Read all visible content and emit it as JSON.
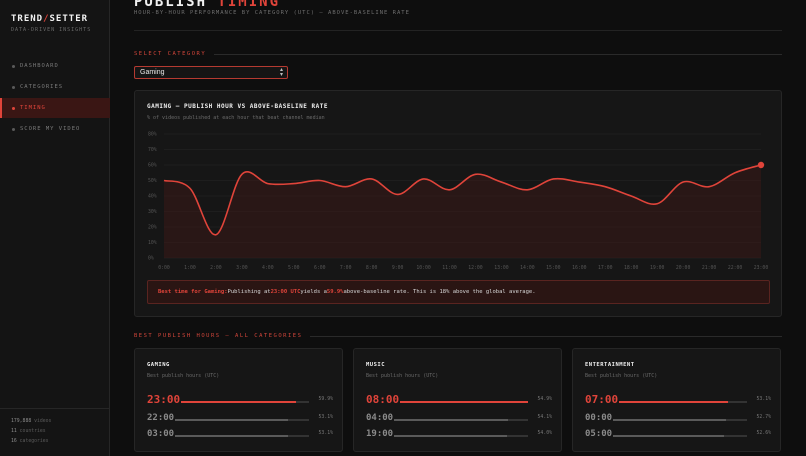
{
  "brand": {
    "name_left": "TREND",
    "name_sep": "/",
    "name_right": "SETTER",
    "tagline": "DATA-DRIVEN INSIGHTS"
  },
  "nav": [
    {
      "label": "DASHBOARD",
      "active": false
    },
    {
      "label": "CATEGORIES",
      "active": false
    },
    {
      "label": "TIMING",
      "active": true
    },
    {
      "label": "SCORE MY VIDEO",
      "active": false
    }
  ],
  "stats": [
    {
      "value": "179,888",
      "label": "videos"
    },
    {
      "value": "11",
      "label": "countries"
    },
    {
      "value": "16",
      "label": "categories"
    }
  ],
  "header": {
    "title_left": "PUBLISH",
    "title_right": "TIMING",
    "subtitle": "HOUR-BY-HOUR PERFORMANCE BY CATEGORY (UTC) — ABOVE-BASELINE RATE"
  },
  "select_section": {
    "label": "SELECT CATEGORY",
    "selected": "Gaming"
  },
  "chart_card": {
    "title": "GAMING — PUBLISH HOUR VS ABOVE-BASELINE RATE",
    "subtitle": "% of videos published at each hour that beat channel median"
  },
  "chart_data": {
    "type": "area",
    "x": [
      "0:00",
      "1:00",
      "2:00",
      "3:00",
      "4:00",
      "5:00",
      "6:00",
      "7:00",
      "8:00",
      "9:00",
      "10:00",
      "11:00",
      "12:00",
      "13:00",
      "14:00",
      "15:00",
      "16:00",
      "17:00",
      "18:00",
      "19:00",
      "20:00",
      "21:00",
      "22:00",
      "23:00"
    ],
    "series": [
      {
        "values": [
          50,
          45,
          15,
          54,
          48,
          48,
          50,
          46,
          51,
          41,
          51,
          44,
          54,
          49,
          44,
          51,
          49,
          46,
          40,
          35,
          49,
          46,
          55,
          60
        ]
      }
    ],
    "yticks": [
      "0%",
      "10%",
      "20%",
      "30%",
      "40%",
      "50%",
      "60%",
      "70%",
      "80%"
    ],
    "ylim": [
      0,
      80
    ],
    "grid": true,
    "highlight_x": "23:00",
    "colors": {
      "line": "#e0443a",
      "fill": "#3a1a17",
      "grid": "#262626",
      "tick": "#555555"
    }
  },
  "callout": {
    "lead": "Best time for Gaming:",
    "text1": " Publishing at ",
    "hour": "23:00 UTC",
    "text2": " yields a ",
    "rate": "59.9%",
    "text3": " above-baseline rate. This is 18% above the global average."
  },
  "best_section": {
    "label": "BEST PUBLISH HOURS — ALL CATEGORIES"
  },
  "hour_cards": [
    {
      "name": "GAMING",
      "sub": "Best publish hours (UTC)",
      "rows": [
        {
          "time": "23:00",
          "pct": "59.9%",
          "fill": 0.9
        },
        {
          "time": "22:00",
          "pct": "53.1%",
          "fill": 0.84
        },
        {
          "time": "03:00",
          "pct": "53.1%",
          "fill": 0.84
        }
      ]
    },
    {
      "name": "MUSIC",
      "sub": "Best publish hours (UTC)",
      "rows": [
        {
          "time": "08:00",
          "pct": "54.9%",
          "fill": 1.0
        },
        {
          "time": "04:00",
          "pct": "54.1%",
          "fill": 0.85
        },
        {
          "time": "19:00",
          "pct": "54.0%",
          "fill": 0.84
        }
      ]
    },
    {
      "name": "ENTERTAINMENT",
      "sub": "Best publish hours (UTC)",
      "rows": [
        {
          "time": "07:00",
          "pct": "53.1%",
          "fill": 0.85
        },
        {
          "time": "00:00",
          "pct": "52.7%",
          "fill": 0.84
        },
        {
          "time": "05:00",
          "pct": "52.6%",
          "fill": 0.83
        }
      ]
    }
  ]
}
